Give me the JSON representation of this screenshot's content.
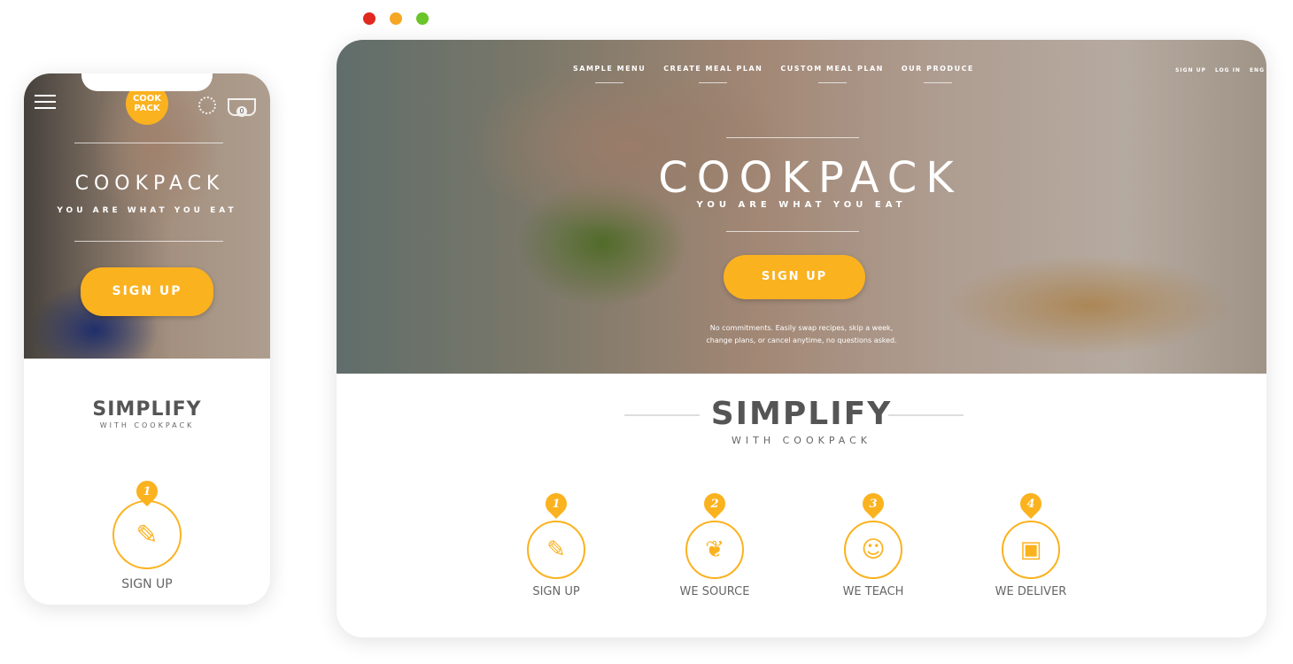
{
  "window_controls": {
    "close_color": "#e0291f",
    "minimize_color": "#f5a623",
    "maximize_color": "#6ac42a"
  },
  "brand": {
    "name": "COOKPACK",
    "tagline": "YOU ARE WHAT YOU EAT",
    "logo_text": "COOK PACK",
    "accent": "#fbb21f"
  },
  "desktop": {
    "nav": [
      "SAMPLE MENU",
      "CREATE MEAL PLAN",
      "CUSTOM MEAL PLAN",
      "OUR PRODUCE"
    ],
    "account_nav": [
      "SIGN UP",
      "LOG IN",
      "ENG"
    ],
    "cta": "SIGN UP",
    "note_line1": "No commitments. Easily swap recipes, skip a week,",
    "note_line2": "change plans, or cancel anytime, no questions asked.",
    "section_title": "SIMPLIFY",
    "section_subtitle": "WITH COOKPACK",
    "steps": [
      {
        "number": "1",
        "label": "SIGN UP",
        "icon": "pencil-icon"
      },
      {
        "number": "2",
        "label": "WE SOURCE",
        "icon": "plant-icon"
      },
      {
        "number": "3",
        "label": "WE TEACH",
        "icon": "chef-icon"
      },
      {
        "number": "4",
        "label": "WE DELIVER",
        "icon": "box-icon"
      }
    ]
  },
  "mobile": {
    "cart_count": "0",
    "cta": "SIGN UP",
    "section_title": "SIMPLIFY",
    "section_subtitle": "WITH COOKPACK",
    "step": {
      "number": "1",
      "label": "SIGN UP",
      "icon": "pencil-icon"
    }
  }
}
